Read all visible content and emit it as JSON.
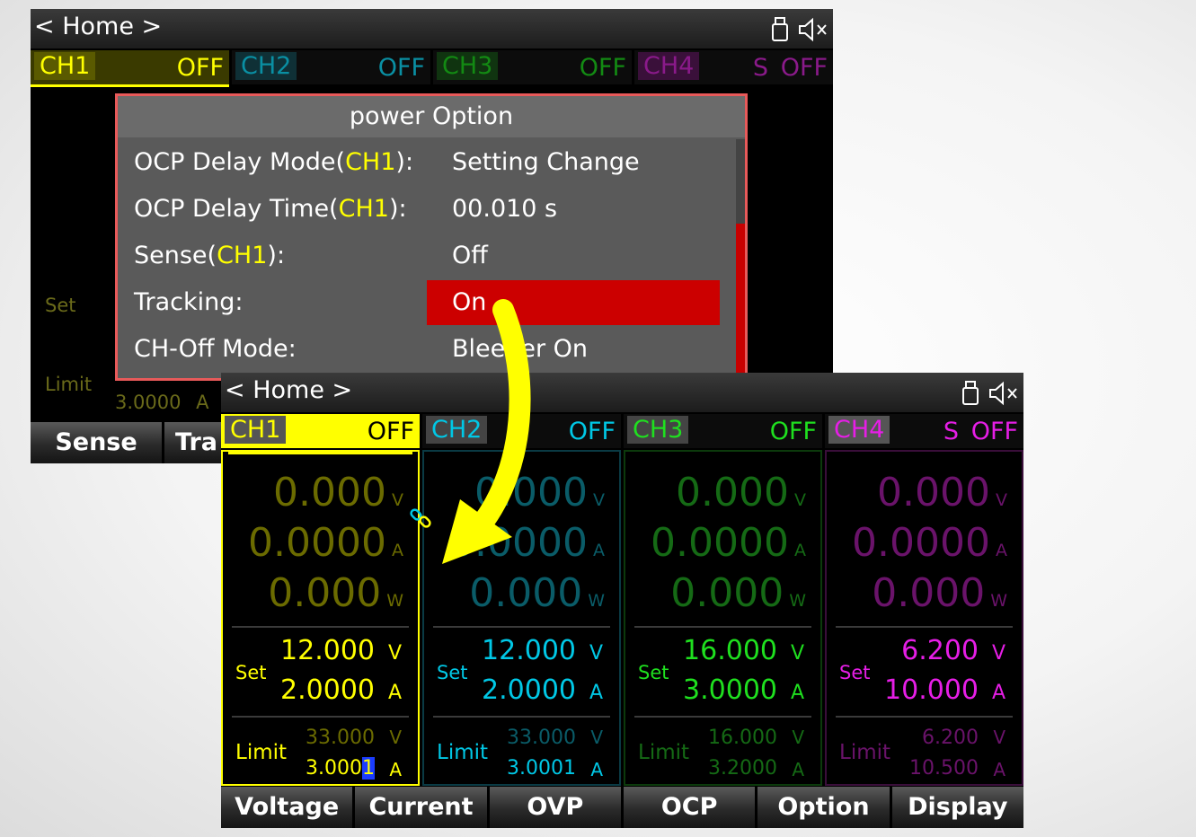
{
  "screens": {
    "back": {
      "title": "< Home >",
      "tabs": [
        {
          "name": "CH1",
          "mode": "",
          "state": "OFF"
        },
        {
          "name": "CH2",
          "mode": "",
          "state": "OFF"
        },
        {
          "name": "CH3",
          "mode": "",
          "state": "OFF"
        },
        {
          "name": "CH4",
          "mode": "S",
          "state": "OFF"
        }
      ],
      "partial_set_label": "Set",
      "partial_limit_label": "Limit",
      "partial_limit_value": "3.0000",
      "partial_limit_unit": "A",
      "softkeys": [
        "Sense",
        "Tra"
      ],
      "dialog": {
        "title": "power Option",
        "rows": [
          {
            "label_pre": "OCP Delay Mode(",
            "label_ch": "CH1",
            "label_post": "):",
            "value": "Setting Change"
          },
          {
            "label_pre": "OCP Delay Time(",
            "label_ch": "CH1",
            "label_post": "):",
            "value": "00.010 s"
          },
          {
            "label_pre": "Sense(",
            "label_ch": "CH1",
            "label_post": "):",
            "value": "Off"
          },
          {
            "label_pre": "Tracking:",
            "label_ch": "",
            "label_post": "",
            "value": "On"
          },
          {
            "label_pre": "CH-Off Mode:",
            "label_ch": "",
            "label_post": "",
            "value": "Bleeder On"
          }
        ],
        "selected_index": 3
      }
    },
    "front": {
      "title": "< Home >",
      "tabs": [
        {
          "name": "CH1",
          "mode": "",
          "state": "OFF"
        },
        {
          "name": "CH2",
          "mode": "",
          "state": "OFF"
        },
        {
          "name": "CH3",
          "mode": "",
          "state": "OFF"
        },
        {
          "name": "CH4",
          "mode": "S",
          "state": "OFF"
        }
      ],
      "channels": [
        {
          "volt": "0.000",
          "amp": "0.0000",
          "watt": "0.000",
          "set_label": "Set",
          "set_v": "12.000",
          "set_a": "2.0000",
          "limit_label": "Limit",
          "limit_v": "33.000",
          "limit_a_prefix": "3.000",
          "limit_a_cursor": "1"
        },
        {
          "volt": "0.000",
          "amp": "0.0000",
          "watt": "0.000",
          "set_label": "Set",
          "set_v": "12.000",
          "set_a": "2.0000",
          "limit_label": "Limit",
          "limit_v": "33.000",
          "limit_a_prefix": "3.0001",
          "limit_a_cursor": ""
        },
        {
          "volt": "0.000",
          "amp": "0.0000",
          "watt": "0.000",
          "set_label": "Set",
          "set_v": "16.000",
          "set_a": "3.0000",
          "limit_label": "Limit",
          "limit_v": "16.000",
          "limit_a_prefix": "3.2000",
          "limit_a_cursor": ""
        },
        {
          "volt": "0.000",
          "amp": "0.0000",
          "watt": "0.000",
          "set_label": "Set",
          "set_v": "6.200",
          "set_a": "10.000",
          "limit_label": "Limit",
          "limit_v": "6.200",
          "limit_a_prefix": "10.500",
          "limit_a_cursor": ""
        }
      ],
      "units": {
        "v": "V",
        "a": "A",
        "w": "W"
      },
      "softkeys": [
        "Voltage",
        "Current",
        "OVP",
        "OCP",
        "Option",
        "Display"
      ]
    }
  },
  "colors": {
    "ch1": "#ffff00",
    "ch2": "#00c8e6",
    "ch3": "#1fe01f",
    "ch4": "#e61ee6",
    "arrow": "#ffff00",
    "dialog_border": "#e85a5a",
    "selection": "#cc0000"
  },
  "icons": {
    "usb": "usb-drive-icon",
    "mute": "speaker-muted-icon",
    "tracking": "tracking-link-icon"
  }
}
